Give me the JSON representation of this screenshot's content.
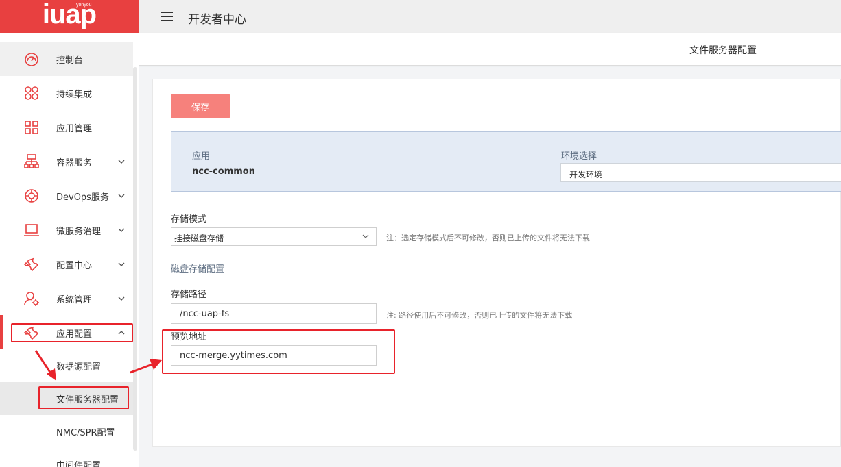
{
  "logo": {
    "text": "iuap",
    "sub": "yonyou"
  },
  "header": {
    "title": "开发者中心"
  },
  "subheader": {
    "title": "文件服务器配置"
  },
  "sidebar": {
    "items": [
      {
        "label": "控制台",
        "icon": "dashboard-icon"
      },
      {
        "label": "持续集成",
        "icon": "cluster-icon"
      },
      {
        "label": "应用管理",
        "icon": "grid-icon"
      },
      {
        "label": "容器服务",
        "icon": "hierarchy-icon"
      },
      {
        "label": "DevOps服务",
        "icon": "lifebuoy-icon"
      },
      {
        "label": "微服务治理",
        "icon": "laptop-icon"
      },
      {
        "label": "配置中心",
        "icon": "wrench-icon"
      },
      {
        "label": "系统管理",
        "icon": "user-gear-icon"
      },
      {
        "label": "应用配置",
        "icon": "wrench-icon"
      }
    ],
    "subitems": [
      {
        "label": "数据源配置"
      },
      {
        "label": "文件服务器配置"
      },
      {
        "label": "NMC/SPR配置"
      },
      {
        "label": "中间件配置"
      }
    ]
  },
  "form": {
    "save_label": "保存",
    "app_label": "应用",
    "app_value": "ncc-common",
    "env_label": "环境选择",
    "env_value": "开发环境",
    "storage_mode_label": "存储模式",
    "storage_mode_value": "挂接磁盘存储",
    "storage_mode_hint": "注：选定存储模式后不可修改，否则已上传的文件将无法下载",
    "disk_section_title": "磁盘存储配置",
    "storage_path_label": "存储路径",
    "storage_path_value": "/ncc-uap-fs",
    "storage_path_hint": "注: 路径使用后不可修改，否则已上传的文件将无法下载",
    "preview_label": "预览地址",
    "preview_value": "ncc-merge.yytimes.com"
  },
  "colors": {
    "brand": "#e84040",
    "save": "#f6817c",
    "annotation": "#e8232b"
  }
}
